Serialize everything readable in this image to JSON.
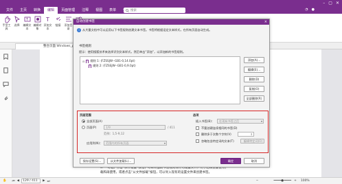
{
  "menu": [
    "文件",
    "主页",
    "转换",
    "编辑",
    "页面管理",
    "注释",
    "视图",
    "表单",
    "保护",
    "共享",
    "辅助工具",
    "帮助"
  ],
  "active_menu_index": 3,
  "search": {
    "placeholder": "搜索"
  },
  "ribbon": [
    {
      "label": "手型工具"
    },
    {
      "label": "选择"
    },
    {
      "label": "编辑文本"
    },
    {
      "label": "编辑对象"
    },
    {
      "label": "添加文本"
    },
    {
      "label": "链接"
    },
    {
      "label": "添加目录"
    },
    {
      "label": "形状"
    }
  ],
  "doc_tab": {
    "label": "整合页面 Windows_pdf..."
  },
  "dialog": {
    "title": "自动创建书签",
    "close": "×",
    "info": "从大量文档中可以运用以下书签规则创建文本书签。书签将根据设定文本样式，在所有页面自动生成。",
    "bookmark_section": "书签规则",
    "hint": "提示：使用搜狐技术来选择识别文本样式，然后单击“添加”，以添加新的书签规则。",
    "tree": [
      {
        "label": "规则 1: (FZSSJW--GB1-0,14.0pt)"
      },
      {
        "label": "规则 2: (FZSSJW--GB1-0,9.0pt)"
      }
    ],
    "side_buttons": [
      "添加(A)...",
      "编辑(E)...",
      "删除(D)",
      "复制(O)",
      "全部删除(R)"
    ],
    "page_range": {
      "heading": "页面范围",
      "all_pages": "全部页面(A)",
      "pages": "页面(P)",
      "pages_value": "1/9",
      "pages_total": "/ 411",
      "example": "范例：1,5-9,12",
      "apply_to": "应用到(N)：",
      "apply_value": "范围内的所有页面"
    },
    "options": {
      "heading": "选项",
      "insert_label": "插入书签(B)：",
      "insert_value": "在现有书签之后",
      "opt1": "不要创建连续相同的书签(D)",
      "opt2": "删除多于次数个字符(V)",
      "opt3": "忽略包含特定词的文本(T)",
      "opt3_btn": "编辑特定词(O)"
    },
    "footer": {
      "save": "保存设置(S)...",
      "load": "从文件加载(L)...",
      "ok": "确定",
      "cancel": "取消"
    }
  },
  "doc_text": [
    "6. 「可选」点击“保存设置”按钮，可以将当前书签规则保存为设置文件，用于后续重复使用；",
    "载和再使用，或者点击“从文件加载”按钮，可以导入现有的设置文件来创建书签。"
  ],
  "status": {
    "page_value": "129 / 411",
    "zoom": "100%"
  }
}
